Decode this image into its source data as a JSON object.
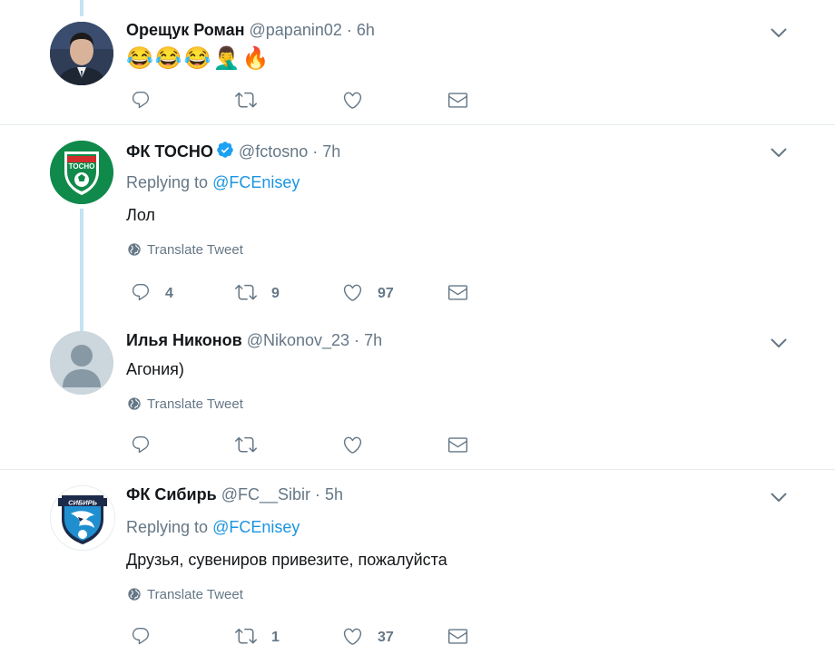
{
  "tweets": [
    {
      "name": "Орещук Роман",
      "handle": "@papanin02",
      "dot": "·",
      "time": "6h",
      "text": "😂😂😂🤦‍♂️🔥",
      "actions": {
        "reply": "",
        "retweet": "",
        "like": ""
      }
    },
    {
      "name": "ФК ТОСНО",
      "handle": "@fctosno",
      "dot": "·",
      "time": "7h",
      "replying_prefix": "Replying to",
      "replying_to": "@FCEnisey",
      "text": "Лол",
      "translate": "Translate Tweet",
      "logo_text": "ТОСНО",
      "actions": {
        "reply": "4",
        "retweet": "9",
        "like": "97"
      }
    },
    {
      "name": "Илья Никонов",
      "handle": "@Nikonov_23",
      "dot": "·",
      "time": "7h",
      "text": "Агония)",
      "translate": "Translate Tweet",
      "actions": {
        "reply": "",
        "retweet": "",
        "like": ""
      }
    },
    {
      "name": "ФК Сибирь",
      "handle": "@FC__Sibir",
      "dot": "·",
      "time": "5h",
      "replying_prefix": "Replying to",
      "replying_to": "@FCEnisey",
      "text": "Друзья, сувениров привезите, пожалуйста",
      "translate": "Translate Tweet",
      "logo_text": "СИБИРЬ",
      "actions": {
        "reply": "",
        "retweet": "1",
        "like": "37"
      }
    }
  ],
  "colors": {
    "link": "#1b95e0",
    "muted": "#657786",
    "thread_line": "#c4e3f3",
    "divider": "#e6ecf0",
    "tosno_green": "#0f8a4a",
    "sibir_navy": "#1c2a4a"
  },
  "icons": [
    "chevron-down-icon",
    "reply-icon",
    "retweet-icon",
    "like-icon",
    "direct-message-icon",
    "globe-icon",
    "verified-badge-icon"
  ]
}
